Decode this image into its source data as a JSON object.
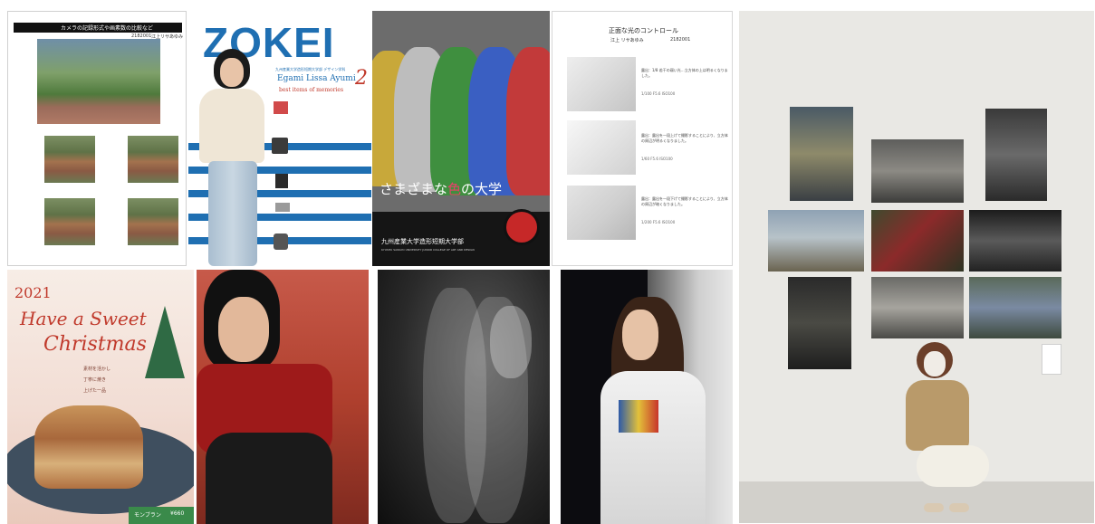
{
  "tiles": {
    "camera_report": {
      "title": "カメラの記録形式や画素数の比較など",
      "meta_id": "2182001",
      "meta_name": "江上リサあゆみ"
    },
    "zokei": {
      "title": "ZOKEI",
      "subtitle_jp": "九州産業大学造形短期大学部 デザイン学科",
      "author": "Egami Lissa Ayumi",
      "issue": "2",
      "tagline": "best items of memories"
    },
    "color_poster": {
      "headline_pre": "さまざまな",
      "headline_accent": "色",
      "headline_post": "の大学",
      "school_jp": "九州産業大学造形短期大学部",
      "school_en": "KYUSHU SANGYO UNIVERSITY JUNIOR COLLEGE OF ART AND DESIGN"
    },
    "light_control": {
      "title": "正面な光のコントロール",
      "author": "江上 リサあゆみ",
      "id": "2182001",
      "rows": [
        {
          "caption": "露出：1/8 若干の弱い光…立方体の上は明るくなりました。",
          "settings": "1/100 F5.6 ISO100"
        },
        {
          "caption": "露出：露出を一段上げて撮影することにより、立方体の周辺が明るくなりました。",
          "settings": "1/60 F5.6 ISO100"
        },
        {
          "caption": "露出：露出を一段下げて撮影することにより、立方体の周辺が暗くなりました。",
          "settings": "1/200 F5.6 ISO100"
        }
      ]
    },
    "christmas": {
      "year": "2021",
      "line1": "Have a Sweet",
      "line2": "Christmas",
      "copy": [
        "素材を活かし",
        "丁寧に焼き",
        "上げた一品"
      ],
      "product": "モンブラン",
      "price": "¥660"
    }
  },
  "colors": {
    "zokei_blue": "#1f6fb2",
    "christmas_red": "#c0392b",
    "poster_accent": "#e8406a"
  }
}
